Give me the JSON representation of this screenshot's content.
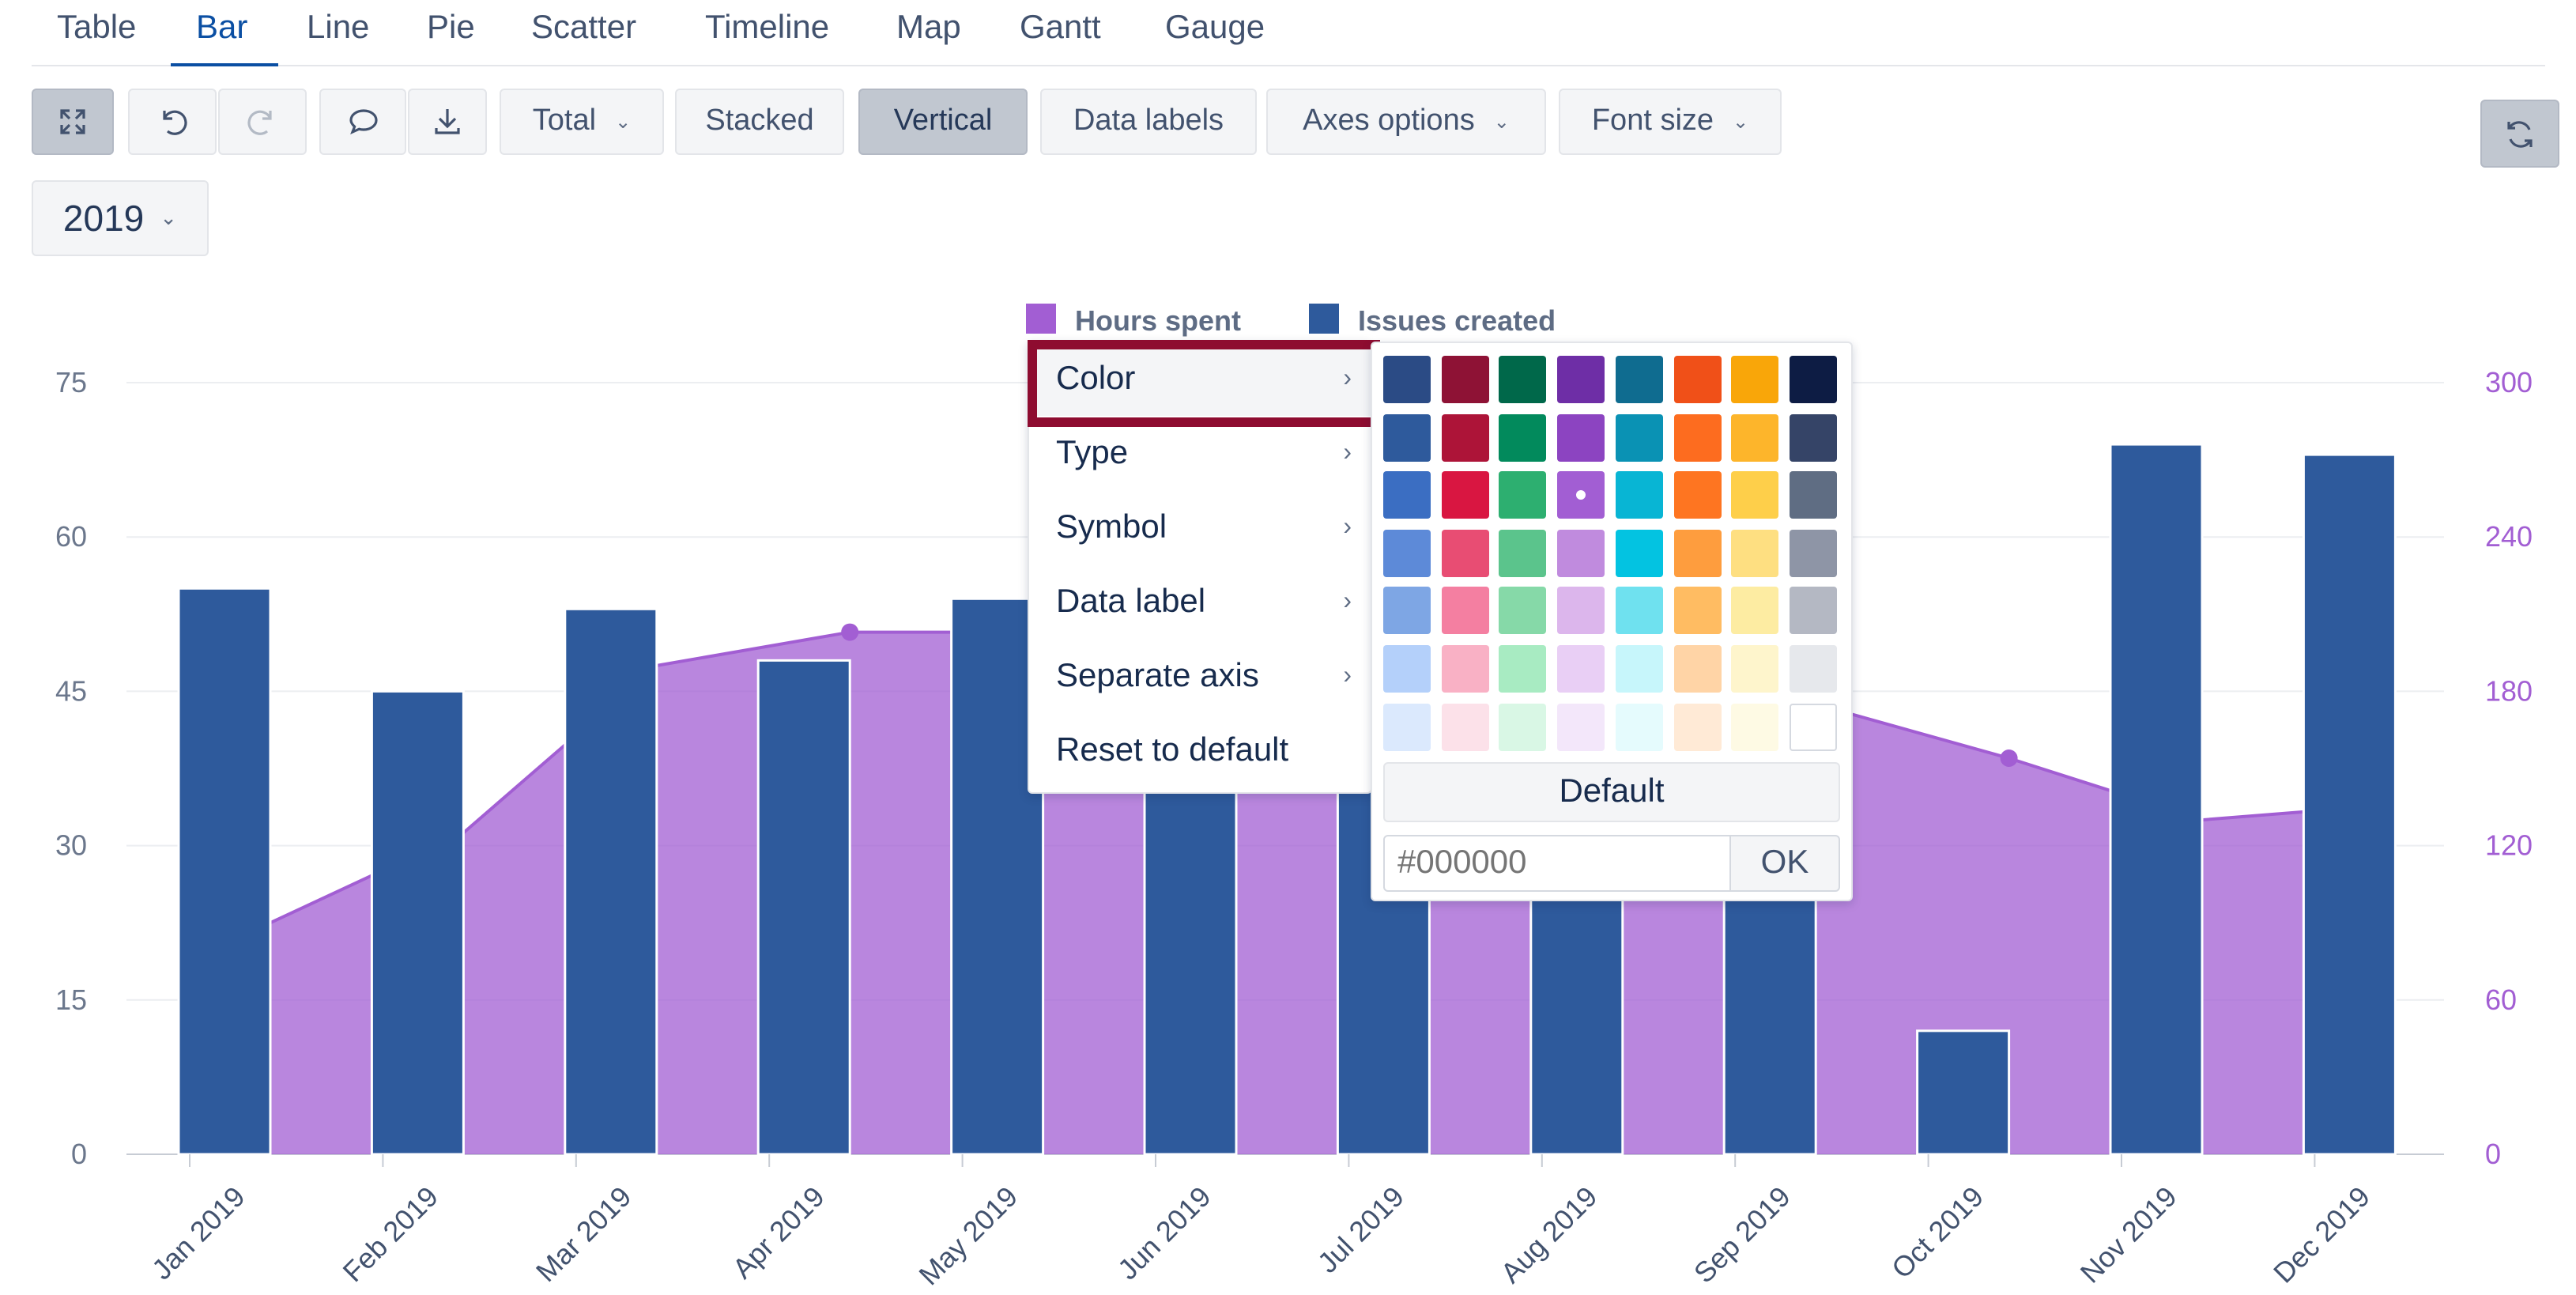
{
  "tabs": [
    {
      "label": "Table"
    },
    {
      "label": "Bar"
    },
    {
      "label": "Line"
    },
    {
      "label": "Pie"
    },
    {
      "label": "Scatter"
    },
    {
      "label": "Timeline"
    },
    {
      "label": "Map"
    },
    {
      "label": "Gantt"
    },
    {
      "label": "Gauge"
    }
  ],
  "active_tab": "Bar",
  "toolbar": {
    "fullscreen_icon": "expand-icon",
    "undo_icon": "undo-icon",
    "redo_icon": "redo-icon",
    "comment_icon": "comment-icon",
    "download_icon": "download-icon",
    "total_label": "Total",
    "stacked_label": "Stacked",
    "vertical_label": "Vertical",
    "data_labels_label": "Data labels",
    "axes_options_label": "Axes options",
    "font_size_label": "Font size",
    "refresh_icon": "refresh-icon"
  },
  "year_selector": {
    "value": "2019"
  },
  "context_menu": {
    "items": [
      {
        "label": "Color"
      },
      {
        "label": "Type"
      },
      {
        "label": "Symbol"
      },
      {
        "label": "Data label"
      },
      {
        "label": "Separate axis"
      },
      {
        "label": "Reset to default"
      }
    ],
    "highlighted": "Color",
    "highlight_color": "#8e0c30"
  },
  "color_picker": {
    "rows": [
      [
        "#2b4b85",
        "#8e1235",
        "#00684a",
        "#6e2ea6",
        "#0f6c90",
        "#f05018",
        "#f9a609",
        "#0d1c44"
      ],
      [
        "#2e5a9c",
        "#ad1438",
        "#028a5c",
        "#8c44c1",
        "#0a92b4",
        "#fd6c1f",
        "#fdb52b",
        "#354467"
      ],
      [
        "#3b6ec2",
        "#d91641",
        "#2daf70",
        "#a25ed3",
        "#08b5d4",
        "#fe7521",
        "#fecf4a",
        "#5f6d83"
      ],
      [
        "#5d8ad8",
        "#e84d73",
        "#5bc48c",
        "#c08bde",
        "#03c3e1",
        "#fe9d3e",
        "#fedf81",
        "#8e95a6"
      ],
      [
        "#7ea6e4",
        "#f47fa1",
        "#86d9a8",
        "#dcb6ec",
        "#6fe1ef",
        "#ffbc62",
        "#fdeca2",
        "#b4b8c3"
      ],
      [
        "#b4d0fa",
        "#f9b1c5",
        "#a8ebc2",
        "#e9cff5",
        "#c7f6fb",
        "#ffd4a6",
        "#fef5cc",
        "#e6e8ec"
      ],
      [
        "#dbe9fd",
        "#fce1e9",
        "#d9f7e5",
        "#f3e7fa",
        "#e5fbfd",
        "#ffead6",
        "#fefae4",
        "#ffffff"
      ]
    ],
    "selected": {
      "row": 2,
      "col": 3
    },
    "default_label": "Default",
    "hex_placeholder": "#000000",
    "ok_label": "OK"
  },
  "chart_data": {
    "type": "bar",
    "categories": [
      "Jan 2019",
      "Feb 2019",
      "Mar 2019",
      "Apr 2019",
      "May 2019",
      "Jun 2019",
      "Jul 2019",
      "Aug 2019",
      "Sep 2019",
      "Oct 2019",
      "Nov 2019",
      "Dec 2019"
    ],
    "series": [
      {
        "name": "Hours spent",
        "type": "area",
        "axis": "right",
        "color": "#a25ed3",
        "values": [
          90,
          125,
          190,
          203,
          203,
          198,
          190,
          180,
          175,
          154,
          130,
          136
        ]
      },
      {
        "name": "Issues created",
        "type": "bar",
        "axis": "left",
        "color": "#2e5a9c",
        "values": [
          55,
          45,
          53,
          48,
          54,
          50,
          52,
          44,
          41,
          12,
          69,
          68
        ]
      }
    ],
    "left_axis": {
      "ylim": [
        0,
        75
      ],
      "ticks": [
        "0",
        "15",
        "30",
        "45",
        "60",
        "75"
      ]
    },
    "right_axis": {
      "ylim": [
        0,
        300
      ],
      "ticks": [
        "0",
        "60",
        "120",
        "180",
        "240",
        "300"
      ],
      "color": "#a25ed3"
    },
    "grid": true,
    "legend": "top-center"
  }
}
